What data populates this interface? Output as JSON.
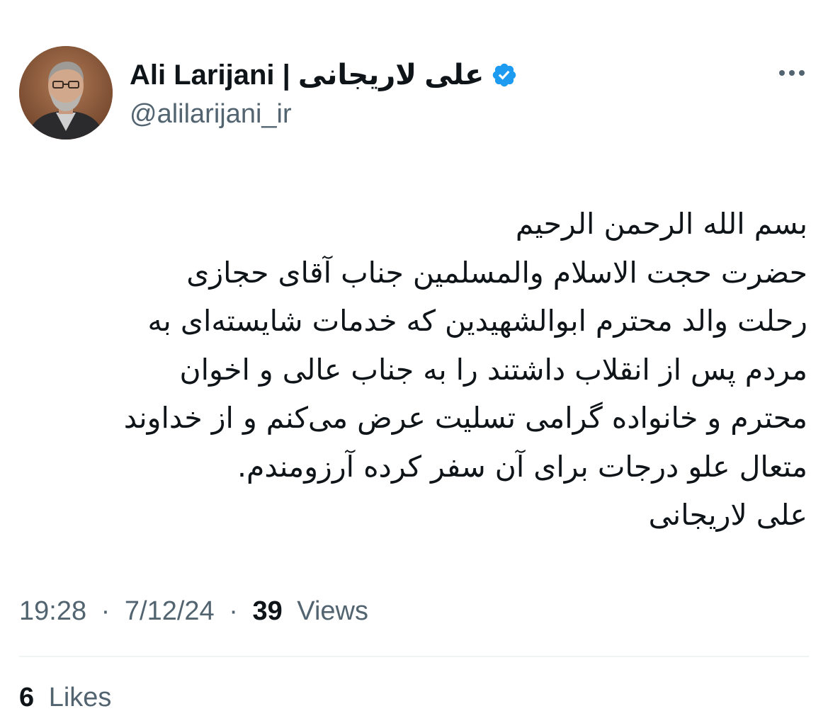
{
  "author": {
    "display_name": "Ali Larijani | علی لاریجانی",
    "handle": "@alilarijani_ir",
    "verified_icon": "verified-badge-icon",
    "verified_color": "#1d9bf0",
    "avatar": "profile-photo"
  },
  "more_icon": "more-horizontal-icon",
  "tweet": {
    "lines": [
      "بسم الله الرحمن الرحیم",
      "حضرت حجت الاسلام والمسلمین جناب آقای حجازی",
      "رحلت والد محترم ابوالشهیدین که خدمات شایسته‌ای به",
      "مردم پس از انقلاب داشتند را به جناب عالی و اخوان",
      "محترم و خانواده گرامی تسلیت عرض می‌کنم و از خداوند",
      "متعال علو درجات برای آن سفر کرده آرزومندم.",
      "علی لاریجانی"
    ]
  },
  "meta": {
    "time": "19:28",
    "separator": "·",
    "date": "7/12/24",
    "views_count": "39",
    "views_label": "Views"
  },
  "stats": {
    "likes_count": "6",
    "likes_label": "Likes"
  },
  "colors": {
    "text_primary": "#0f1419",
    "text_secondary": "#536471",
    "divider": "#eff3f4",
    "verified": "#1d9bf0"
  }
}
